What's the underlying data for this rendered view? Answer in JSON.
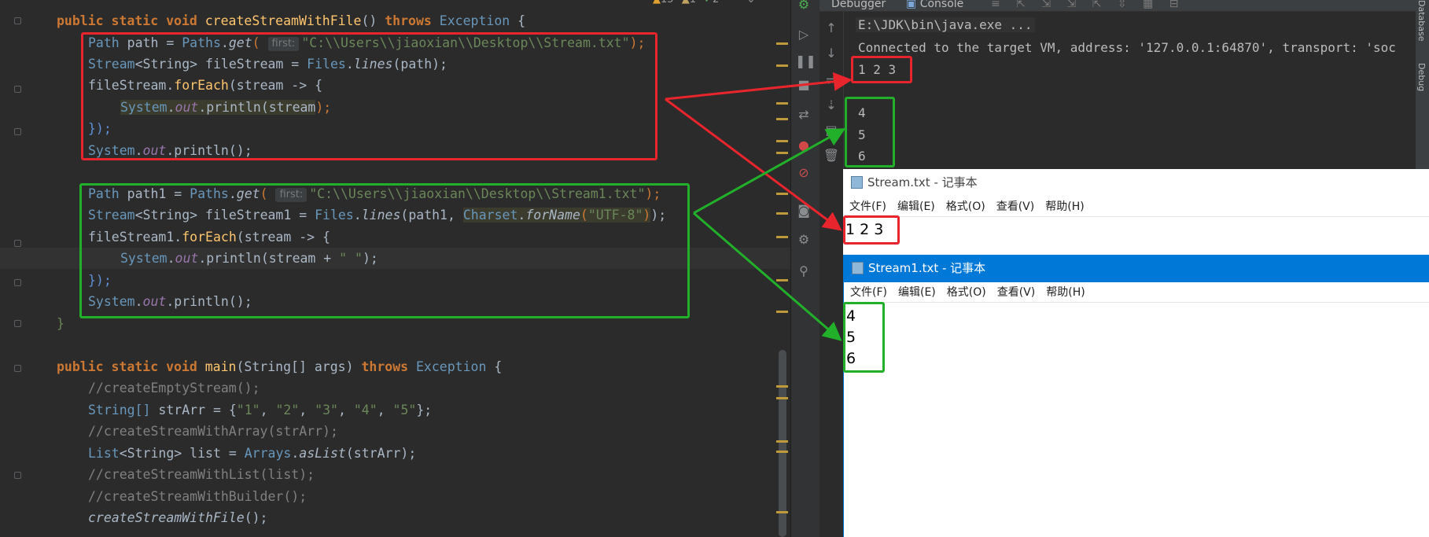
{
  "editor": {
    "lines": {
      "l1": {
        "mod": "public static void",
        "name": "createStreamWithFile",
        "rest1": "() ",
        "throws": "throws",
        "exc": "Exception",
        "brace": " {"
      },
      "l2": {
        "type": "Path",
        "var": " path = ",
        "cls": "Paths",
        "dot": ".",
        "get": "get",
        "open": "(",
        "hint": "first:",
        "str": "\"C:\\\\Users\\\\jiaoxian\\\\Desktop\\\\Stream.txt\"",
        "close": ");"
      },
      "l3": {
        "type": "Stream",
        "gen": "<String>",
        "var": " fileStream = ",
        "cls": "Files",
        "dot": ".",
        "fn": "lines",
        "args": "(path);"
      },
      "l4": {
        "obj": "fileStream",
        "dot": ".",
        "fn": "forEach",
        "args": "(stream -> {"
      },
      "l5": {
        "sys": "System",
        "dot": ".",
        "out": "out",
        "call": ".println(",
        "arg": "stream",
        "close": ");"
      },
      "l6": {
        "text": "});"
      },
      "l7": {
        "sys": "System",
        "dot": ".",
        "out": "out",
        "call": ".println();"
      },
      "l9": {
        "type": "Path",
        "var": " path1 = ",
        "cls": "Paths",
        "dot": ".",
        "get": "get",
        "open": "(",
        "hint": "first:",
        "str": "\"C:\\\\Users\\\\jiaoxian\\\\Desktop\\\\Stream1.txt\"",
        "close": ");"
      },
      "l10": {
        "type": "Stream",
        "gen": "<String>",
        "var": " fileStream1 = ",
        "cls": "Files",
        "dot": ".",
        "fn": "lines",
        "args": "(path1, ",
        "cs": "Charset",
        "csdot": ".",
        "csfn": "forName",
        "csopen": "(",
        "csstr": "\"UTF-8\"",
        "csclose": ")",
        "close": ");"
      },
      "l11": {
        "obj": "fileStream1",
        "dot": ".",
        "fn": "forEach",
        "args": "(stream -> {"
      },
      "l12": {
        "sys": "System",
        "dot": ".",
        "out": "out",
        "call": ".println(stream + ",
        "str": "\" \"",
        "close": ");"
      },
      "l13": {
        "text": "});"
      },
      "l14": {
        "sys": "System",
        "dot": ".",
        "out": "out",
        "call": ".println();"
      },
      "l15": {
        "text": "}"
      },
      "l17": {
        "mod": "public static void",
        "name": "main",
        "args": "(String[] args) ",
        "throws": "throws",
        "exc": "Exception",
        "brace": " {"
      },
      "l18": {
        "text": "//createEmptyStream();"
      },
      "l19": {
        "type": "String[]",
        "var": " strArr = {",
        "s1": "\"1\"",
        "s2": "\"2\"",
        "s3": "\"3\"",
        "s4": "\"4\"",
        "s5": "\"5\"",
        "sep": ", ",
        "close": "};"
      },
      "l20": {
        "text": "//createStreamWithArray(strArr);"
      },
      "l21": {
        "type": "List",
        "gen": "<String>",
        "var": " list = ",
        "cls": "Arrays",
        "dot": ".",
        "fn": "asList",
        "args": "(strArr);"
      },
      "l22": {
        "text": "//createStreamWithList(list);"
      },
      "l23": {
        "text": "//createStreamWithBuilder();"
      },
      "l24": {
        "fn": "createStreamWithFile",
        "args": "();"
      }
    }
  },
  "inspections": {
    "warnings": "15",
    "weak": "1",
    "typos": "2"
  },
  "tabs": {
    "debugger": "Debugger",
    "console": "Console"
  },
  "console": {
    "cmd": "E:\\JDK\\bin\\java.exe ...",
    "connected": "Connected to the target VM, address: '127.0.0.1:64870', transport: 'soc",
    "out1": "1 2 3",
    "out2": "4",
    "out3": "5",
    "out4": "6"
  },
  "side_panel": {
    "top": "Database",
    "bottom": "Debug"
  },
  "notepad1": {
    "title": "Stream.txt - 记事本",
    "menu": [
      "文件(F)",
      "编辑(E)",
      "格式(O)",
      "查看(V)",
      "帮助(H)"
    ],
    "content": "1 2 3"
  },
  "notepad2": {
    "title": "Stream1.txt - 记事本",
    "menu": [
      "文件(F)",
      "编辑(E)",
      "格式(O)",
      "查看(V)",
      "帮助(H)"
    ],
    "lines": [
      "4",
      "5",
      "6"
    ]
  },
  "colors": {
    "red_annotation": "#e8242c",
    "green_annotation": "#22b02a",
    "notepad_active_title": "#0078d7"
  }
}
